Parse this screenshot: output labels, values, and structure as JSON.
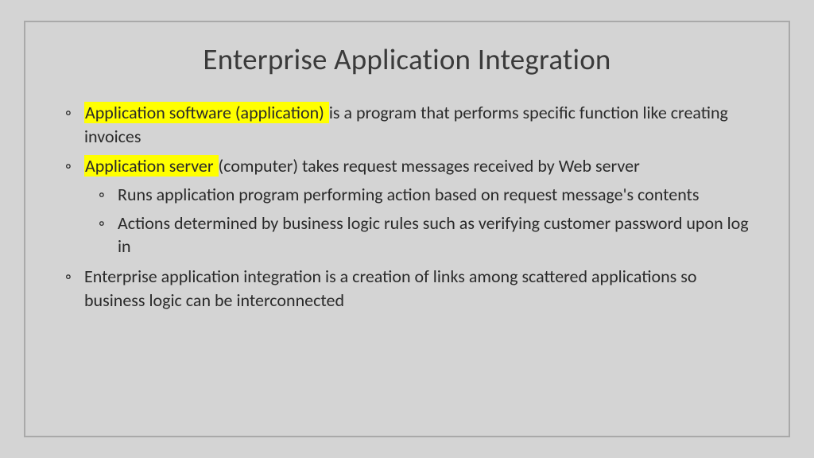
{
  "title": "Enterprise Application Integration",
  "bullets": {
    "b1_hl": "Application software (application) ",
    "b1_rest": "is a program that performs specific function like creating invoices",
    "b2_hl": "Application server ",
    "b2_rest": "(computer) takes request messages received by Web server",
    "b2_sub1": "Runs application program performing action based on request message's contents",
    "b2_sub2": "Actions determined by business logic rules such as  verifying customer password upon log in",
    "b3": "Enterprise application integration is a creation of links among scattered applications so business logic can be interconnected"
  }
}
